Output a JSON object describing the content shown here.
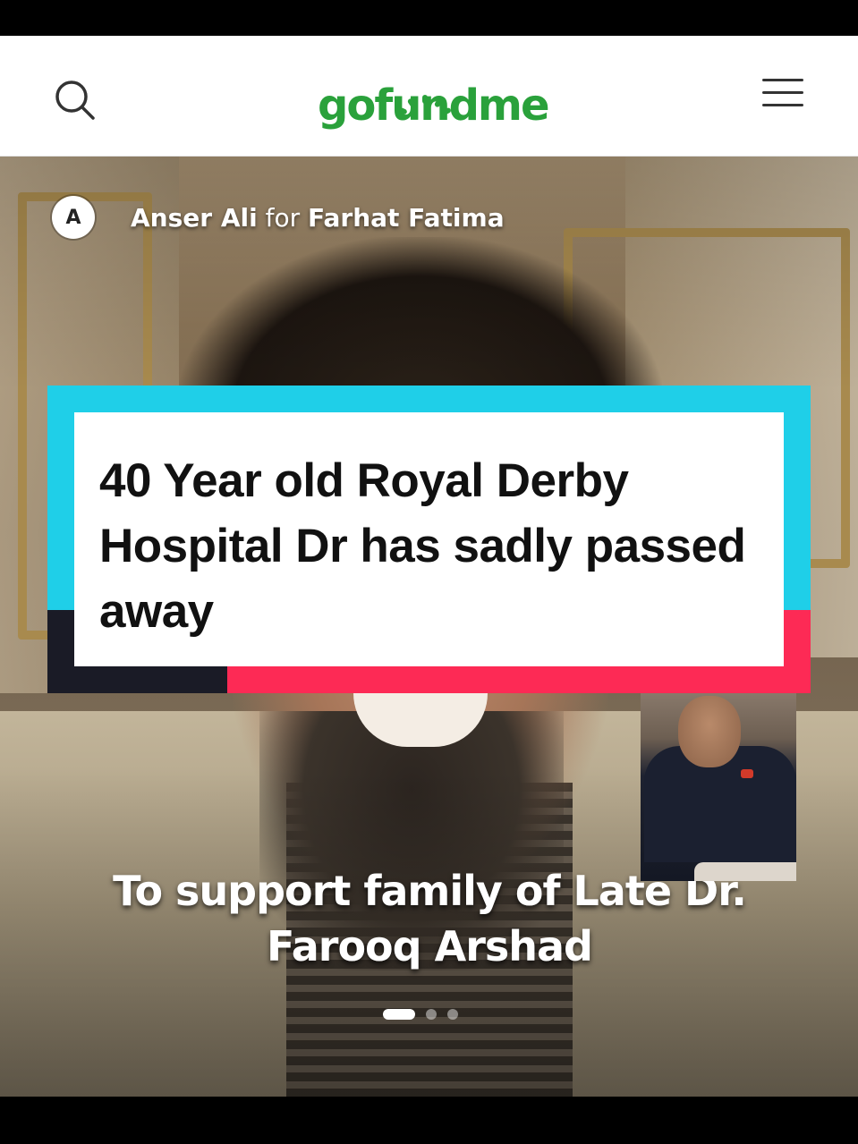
{
  "header": {
    "logo_text": "gofundme",
    "search_icon": "search-icon",
    "menu_icon": "hamburger-menu-icon",
    "brand_color": "#2aa13b"
  },
  "campaign": {
    "organizer_initial": "A",
    "organizer_name": "Anser Ali",
    "for_word": "for",
    "beneficiary": "Farhat Fatima",
    "title": "To support family of Late Dr. Farooq Arshad",
    "carousel_count": 3,
    "carousel_active": 1
  },
  "overlay": {
    "headline": "40 Year old Royal Derby Hospital Dr has sadly passed away",
    "colors": {
      "cyan": "#1fcfe8",
      "red": "#fd2a55",
      "dark": "#1a1b26"
    }
  }
}
